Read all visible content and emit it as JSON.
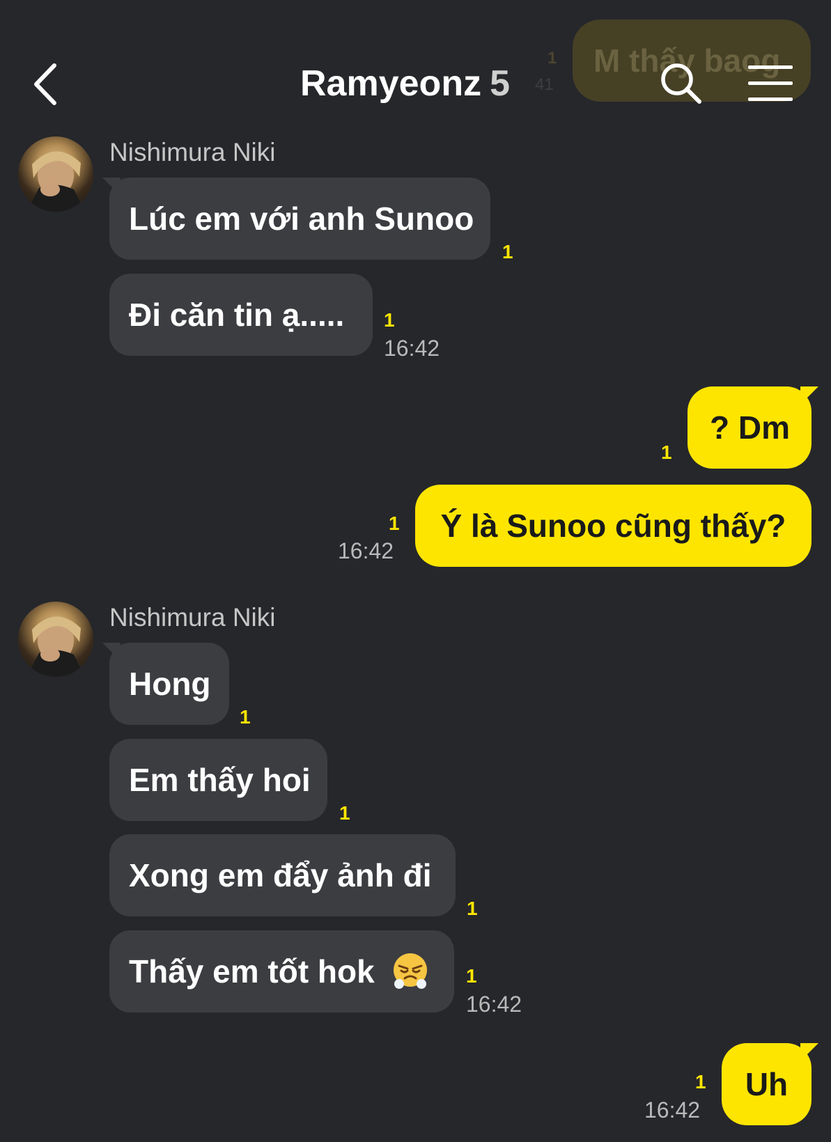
{
  "header": {
    "title": "Ramyeonz",
    "member_count": "5",
    "back_icon": "chevron-left-icon",
    "search_icon": "search-icon",
    "menu_icon": "hamburger-menu-icon"
  },
  "previous_message": {
    "text": "M thấy baog",
    "read_count": "1",
    "time": "41"
  },
  "groups": [
    {
      "sender": "Nishimura Niki",
      "messages": [
        {
          "text": "Lúc em với anh Sunoo",
          "read": "1"
        },
        {
          "text": "Đi căn tin ạ.....",
          "read": "1",
          "time": "16:42"
        }
      ]
    },
    {
      "outgoing": true,
      "messages": [
        {
          "text": "? Dm",
          "read": "1"
        },
        {
          "text": "Ý là Sunoo cũng thấy?",
          "read": "1",
          "time": "16:42"
        }
      ]
    },
    {
      "sender": "Nishimura Niki",
      "messages": [
        {
          "text": "Hong",
          "read": "1"
        },
        {
          "text": "Em thấy hoi",
          "read": "1"
        },
        {
          "text": "Xong em đẩy ảnh đi",
          "read": "1"
        },
        {
          "text": "Thấy em tốt hok",
          "emoji": "huffing-face-emoji",
          "read": "1",
          "time": "16:42"
        }
      ]
    },
    {
      "outgoing": true,
      "messages": [
        {
          "text": "Uh",
          "read": "1",
          "time": "16:42"
        }
      ]
    }
  ],
  "colors": {
    "background": "#26272b",
    "incoming_bubble": "#3c3d41",
    "outgoing_bubble": "#fee500",
    "read_indicator": "#fee500"
  }
}
